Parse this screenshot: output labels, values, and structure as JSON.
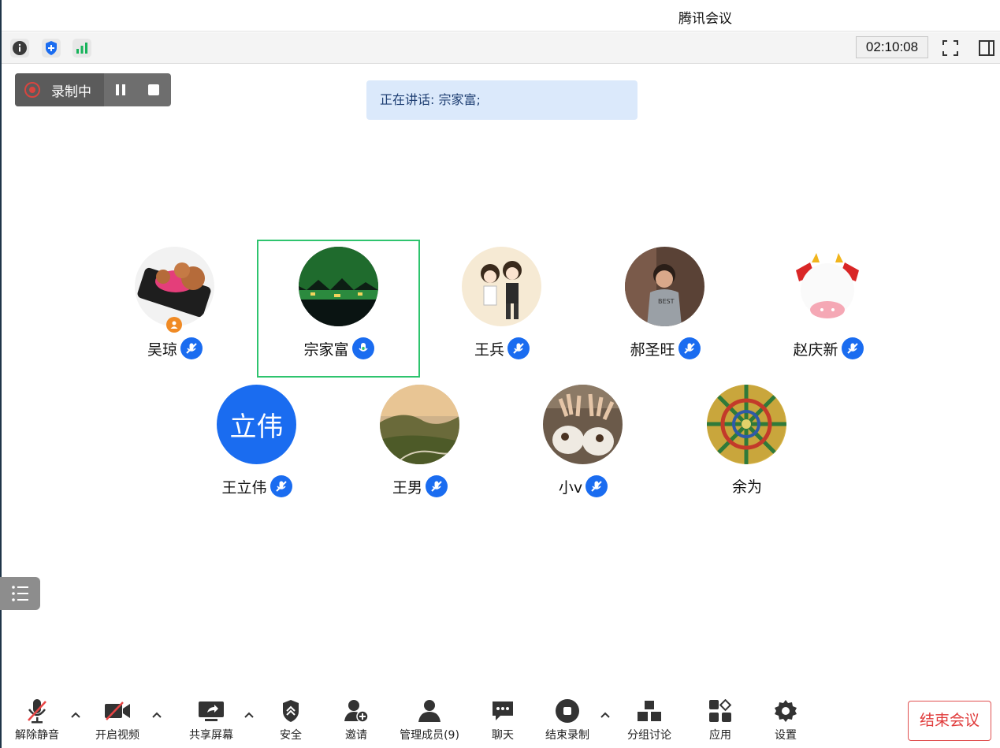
{
  "window": {
    "title": "腾讯会议"
  },
  "status": {
    "icons": [
      "info-icon",
      "security-shield-icon",
      "signal-bars-icon"
    ],
    "timer": "02:10:08",
    "right_icons": [
      "fullscreen-icon",
      "sidebar-toggle-icon"
    ]
  },
  "recording": {
    "label": "录制中"
  },
  "speaking": {
    "text": "正在讲话: 宗家富;"
  },
  "participants": [
    {
      "name": "吴琼",
      "mic": "muted",
      "host": true
    },
    {
      "name": "宗家富",
      "mic": "speaking",
      "active": true
    },
    {
      "name": "王兵",
      "mic": "muted"
    },
    {
      "name": "郝圣旺",
      "mic": "muted"
    },
    {
      "name": "赵庆新",
      "mic": "muted"
    },
    {
      "name": "王立伟",
      "mic": "muted",
      "avatar_text": "立伟"
    },
    {
      "name": "王男",
      "mic": "muted"
    },
    {
      "name": "小v",
      "mic": "muted"
    },
    {
      "name": "余为",
      "mic": "none"
    }
  ],
  "toolbar": {
    "unmute": "解除静音",
    "video": "开启视频",
    "share": "共享屏幕",
    "security": "安全",
    "invite": "邀请",
    "members": "管理成员(9)",
    "chat": "聊天",
    "stop_record": "结束录制",
    "breakout": "分组讨论",
    "apps": "应用",
    "settings": "设置",
    "end": "结束会议"
  },
  "colors": {
    "accent": "#1a6cf0",
    "active_border": "#2ec46e",
    "end": "#e03b3b"
  }
}
